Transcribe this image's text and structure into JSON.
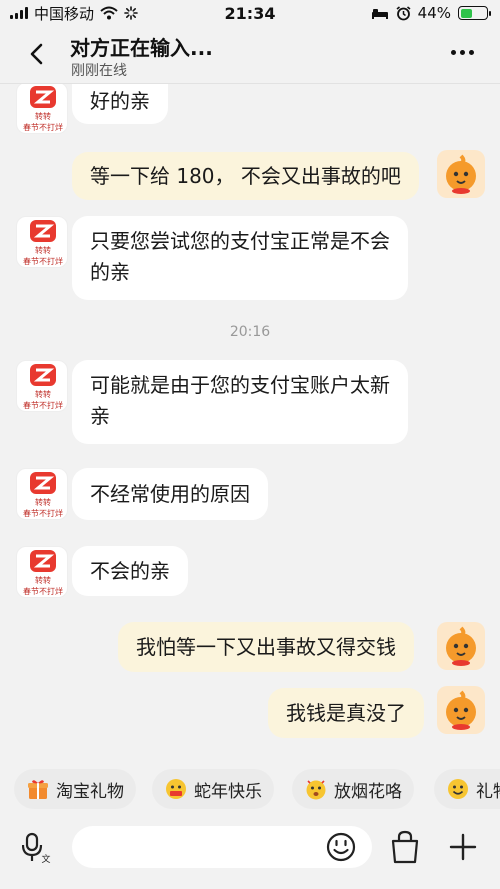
{
  "status_bar": {
    "carrier": "中国移动",
    "time": "21:34",
    "battery": "44%",
    "battery_level": 0.44
  },
  "header": {
    "title": "对方正在输入...",
    "subtitle": "刚刚在线"
  },
  "messages": [
    {
      "side": "in",
      "text": "好的亲"
    },
    {
      "side": "out",
      "text": "等一下给 180， 不会又出事故的吧"
    },
    {
      "side": "in",
      "lines": [
        "只要您尝试您的支付宝正常是不会",
        "的亲"
      ]
    },
    {
      "side": "time",
      "text": "20:16"
    },
    {
      "side": "in",
      "lines": [
        "可能就是由于您的支付宝账户太新",
        "亲"
      ]
    },
    {
      "side": "in",
      "text": "不经常使用的原因"
    },
    {
      "side": "in",
      "text": "不会的亲"
    },
    {
      "side": "out",
      "text": "我怕等一下又出事故又得交钱"
    },
    {
      "side": "out",
      "text": "我钱是真没了"
    }
  ],
  "chips": [
    {
      "label": "淘宝礼物",
      "icon": "gift-icon"
    },
    {
      "label": "蛇年快乐",
      "icon": "happy-face-icon"
    },
    {
      "label": "放烟花咯",
      "icon": "firework-face-icon"
    },
    {
      "label": "礼物",
      "icon": "smile-face-icon"
    }
  ],
  "input": {
    "placeholder": "",
    "voice_icon": "voice-input-icon",
    "emoji_icon": "emoji-icon",
    "bag_icon": "shopping-bag-icon",
    "plus_icon": "plus-icon"
  },
  "colors": {
    "background": "#f2f2f2",
    "incoming_bubble": "#ffffff",
    "outgoing_bubble": "#fbf4dc",
    "shop_badge": "#e8392f",
    "battery": "#2fc24a"
  }
}
